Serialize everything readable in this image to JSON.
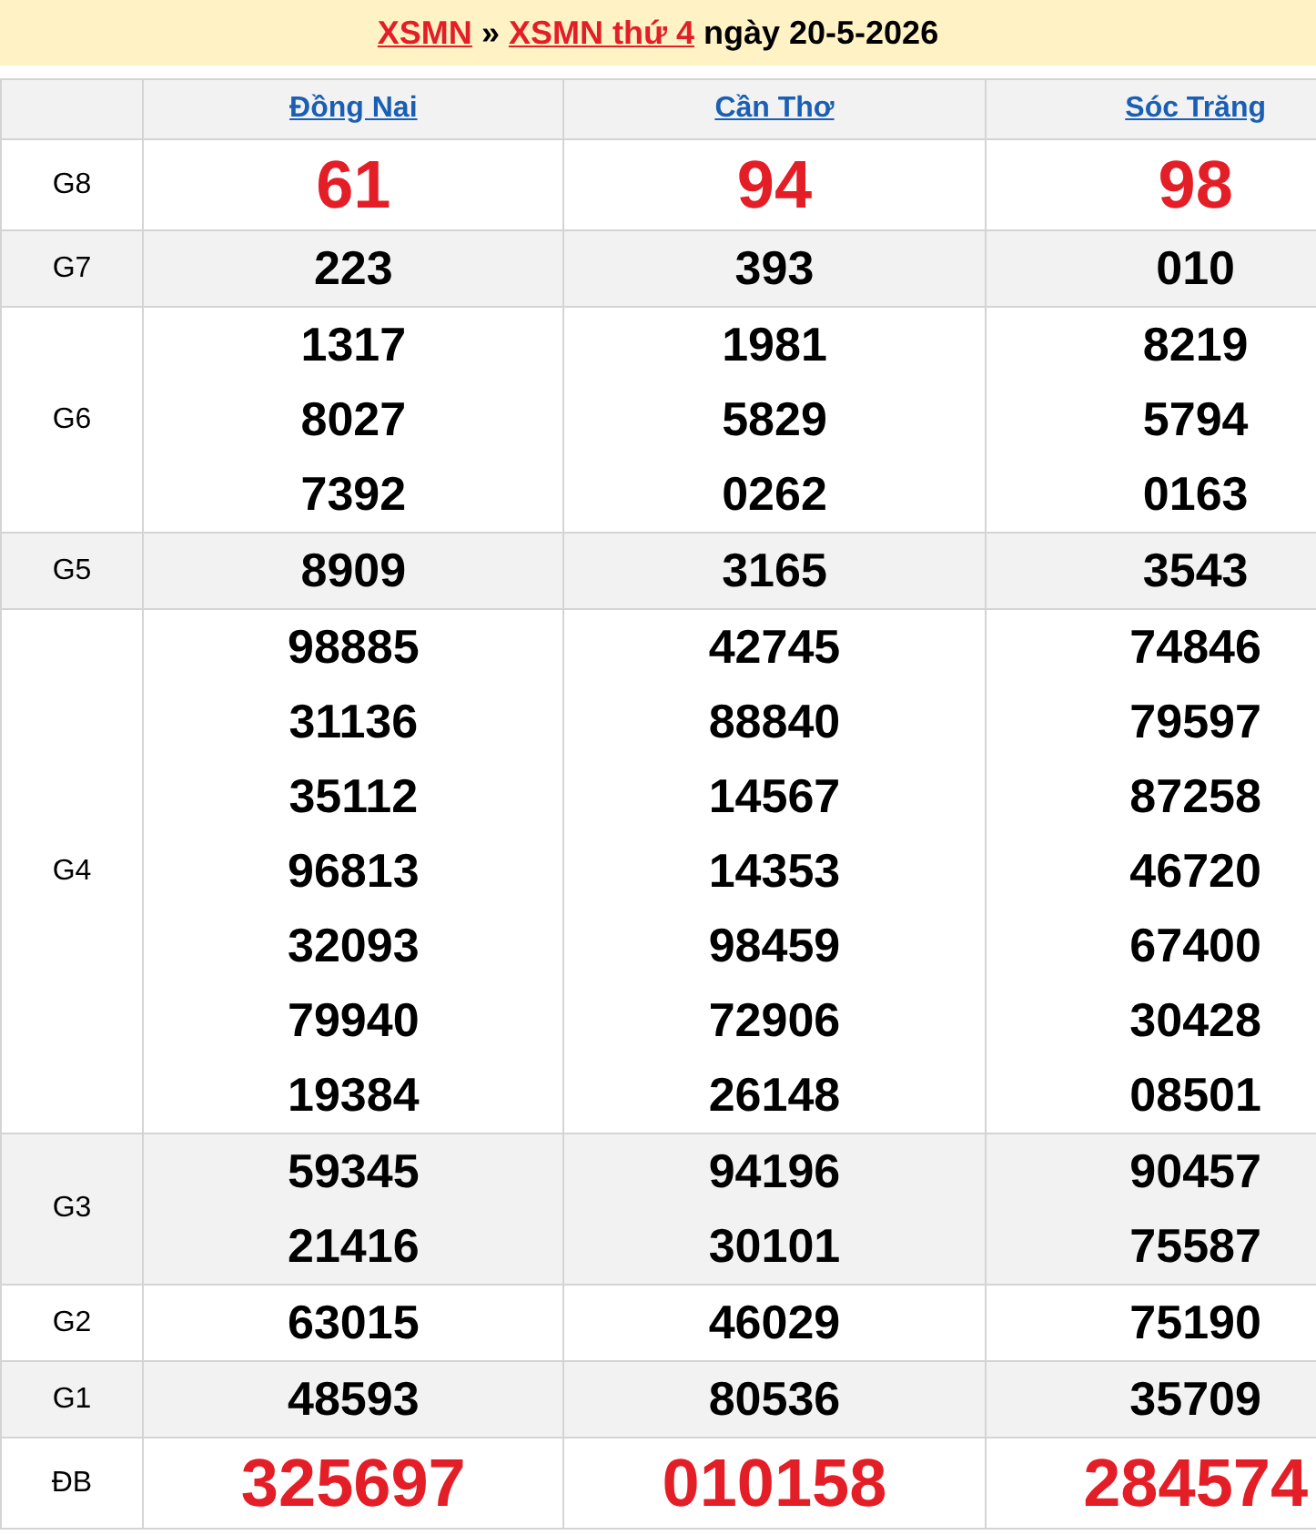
{
  "breadcrumb": [
    {
      "kind": "link",
      "text": "XSMN"
    },
    {
      "kind": "separator",
      "text": "»"
    },
    {
      "kind": "link",
      "text": "XSMN thứ 4"
    },
    {
      "kind": "text",
      "text": "ngày 20-5-2026"
    }
  ],
  "table": {
    "columns": [
      "Đồng Nai",
      "Cần Thơ",
      "Sóc Trăng"
    ],
    "rows": [
      {
        "label": "G8",
        "kind": "highlight",
        "cells": [
          [
            "61"
          ],
          [
            "94"
          ],
          [
            "98"
          ]
        ]
      },
      {
        "label": "G7",
        "kind": "normal",
        "cells": [
          [
            "223"
          ],
          [
            "393"
          ],
          [
            "010"
          ]
        ]
      },
      {
        "label": "G6",
        "kind": "normal",
        "cells": [
          [
            "1317",
            "8027",
            "7392"
          ],
          [
            "1981",
            "5829",
            "0262"
          ],
          [
            "8219",
            "5794",
            "0163"
          ]
        ]
      },
      {
        "label": "G5",
        "kind": "normal",
        "cells": [
          [
            "8909"
          ],
          [
            "3165"
          ],
          [
            "3543"
          ]
        ]
      },
      {
        "label": "G4",
        "kind": "normal",
        "cells": [
          [
            "98885",
            "31136",
            "35112",
            "96813",
            "32093",
            "79940",
            "19384"
          ],
          [
            "42745",
            "88840",
            "14567",
            "14353",
            "98459",
            "72906",
            "26148"
          ],
          [
            "74846",
            "79597",
            "87258",
            "46720",
            "67400",
            "30428",
            "08501"
          ]
        ]
      },
      {
        "label": "G3",
        "kind": "normal",
        "cells": [
          [
            "59345",
            "21416"
          ],
          [
            "94196",
            "30101"
          ],
          [
            "90457",
            "75587"
          ]
        ]
      },
      {
        "label": "G2",
        "kind": "normal",
        "cells": [
          [
            "63015"
          ],
          [
            "46029"
          ],
          [
            "75190"
          ]
        ]
      },
      {
        "label": "G1",
        "kind": "normal",
        "cells": [
          [
            "48593"
          ],
          [
            "80536"
          ],
          [
            "35709"
          ]
        ]
      },
      {
        "label": "ĐB",
        "kind": "highlight",
        "cells": [
          [
            "325697"
          ],
          [
            "010158"
          ],
          [
            "284574"
          ]
        ]
      }
    ]
  }
}
